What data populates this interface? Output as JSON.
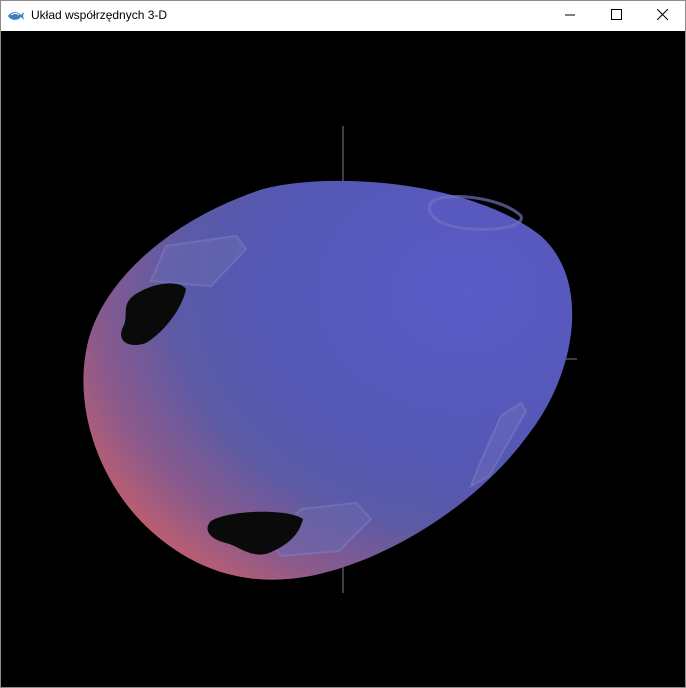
{
  "window": {
    "title": "Układ współrzędnych 3-D",
    "app_icon": "fish-icon",
    "controls": {
      "minimize_icon": "minimize-icon",
      "maximize_icon": "maximize-icon",
      "close_icon": "close-icon"
    }
  },
  "scene": {
    "background_color": "#000000",
    "axis_color": "#7a7a7a",
    "object": "3d-egg-shaped-mesh",
    "colors": {
      "blue": "#5557b8",
      "red_glow": "#d06060",
      "dark_red_band": "#6a1020",
      "hole": "#0a0a0a"
    }
  }
}
